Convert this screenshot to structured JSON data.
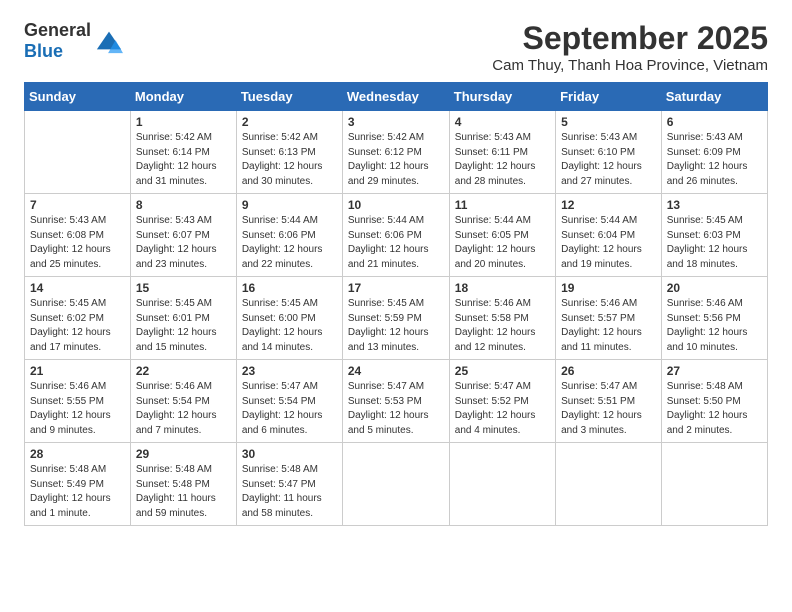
{
  "header": {
    "logo_general": "General",
    "logo_blue": "Blue",
    "month": "September 2025",
    "location": "Cam Thuy, Thanh Hoa Province, Vietnam"
  },
  "weekdays": [
    "Sunday",
    "Monday",
    "Tuesday",
    "Wednesday",
    "Thursday",
    "Friday",
    "Saturday"
  ],
  "weeks": [
    [
      {
        "day": "",
        "info": ""
      },
      {
        "day": "1",
        "info": "Sunrise: 5:42 AM\nSunset: 6:14 PM\nDaylight: 12 hours\nand 31 minutes."
      },
      {
        "day": "2",
        "info": "Sunrise: 5:42 AM\nSunset: 6:13 PM\nDaylight: 12 hours\nand 30 minutes."
      },
      {
        "day": "3",
        "info": "Sunrise: 5:42 AM\nSunset: 6:12 PM\nDaylight: 12 hours\nand 29 minutes."
      },
      {
        "day": "4",
        "info": "Sunrise: 5:43 AM\nSunset: 6:11 PM\nDaylight: 12 hours\nand 28 minutes."
      },
      {
        "day": "5",
        "info": "Sunrise: 5:43 AM\nSunset: 6:10 PM\nDaylight: 12 hours\nand 27 minutes."
      },
      {
        "day": "6",
        "info": "Sunrise: 5:43 AM\nSunset: 6:09 PM\nDaylight: 12 hours\nand 26 minutes."
      }
    ],
    [
      {
        "day": "7",
        "info": "Sunrise: 5:43 AM\nSunset: 6:08 PM\nDaylight: 12 hours\nand 25 minutes."
      },
      {
        "day": "8",
        "info": "Sunrise: 5:43 AM\nSunset: 6:07 PM\nDaylight: 12 hours\nand 23 minutes."
      },
      {
        "day": "9",
        "info": "Sunrise: 5:44 AM\nSunset: 6:06 PM\nDaylight: 12 hours\nand 22 minutes."
      },
      {
        "day": "10",
        "info": "Sunrise: 5:44 AM\nSunset: 6:06 PM\nDaylight: 12 hours\nand 21 minutes."
      },
      {
        "day": "11",
        "info": "Sunrise: 5:44 AM\nSunset: 6:05 PM\nDaylight: 12 hours\nand 20 minutes."
      },
      {
        "day": "12",
        "info": "Sunrise: 5:44 AM\nSunset: 6:04 PM\nDaylight: 12 hours\nand 19 minutes."
      },
      {
        "day": "13",
        "info": "Sunrise: 5:45 AM\nSunset: 6:03 PM\nDaylight: 12 hours\nand 18 minutes."
      }
    ],
    [
      {
        "day": "14",
        "info": "Sunrise: 5:45 AM\nSunset: 6:02 PM\nDaylight: 12 hours\nand 17 minutes."
      },
      {
        "day": "15",
        "info": "Sunrise: 5:45 AM\nSunset: 6:01 PM\nDaylight: 12 hours\nand 15 minutes."
      },
      {
        "day": "16",
        "info": "Sunrise: 5:45 AM\nSunset: 6:00 PM\nDaylight: 12 hours\nand 14 minutes."
      },
      {
        "day": "17",
        "info": "Sunrise: 5:45 AM\nSunset: 5:59 PM\nDaylight: 12 hours\nand 13 minutes."
      },
      {
        "day": "18",
        "info": "Sunrise: 5:46 AM\nSunset: 5:58 PM\nDaylight: 12 hours\nand 12 minutes."
      },
      {
        "day": "19",
        "info": "Sunrise: 5:46 AM\nSunset: 5:57 PM\nDaylight: 12 hours\nand 11 minutes."
      },
      {
        "day": "20",
        "info": "Sunrise: 5:46 AM\nSunset: 5:56 PM\nDaylight: 12 hours\nand 10 minutes."
      }
    ],
    [
      {
        "day": "21",
        "info": "Sunrise: 5:46 AM\nSunset: 5:55 PM\nDaylight: 12 hours\nand 9 minutes."
      },
      {
        "day": "22",
        "info": "Sunrise: 5:46 AM\nSunset: 5:54 PM\nDaylight: 12 hours\nand 7 minutes."
      },
      {
        "day": "23",
        "info": "Sunrise: 5:47 AM\nSunset: 5:54 PM\nDaylight: 12 hours\nand 6 minutes."
      },
      {
        "day": "24",
        "info": "Sunrise: 5:47 AM\nSunset: 5:53 PM\nDaylight: 12 hours\nand 5 minutes."
      },
      {
        "day": "25",
        "info": "Sunrise: 5:47 AM\nSunset: 5:52 PM\nDaylight: 12 hours\nand 4 minutes."
      },
      {
        "day": "26",
        "info": "Sunrise: 5:47 AM\nSunset: 5:51 PM\nDaylight: 12 hours\nand 3 minutes."
      },
      {
        "day": "27",
        "info": "Sunrise: 5:48 AM\nSunset: 5:50 PM\nDaylight: 12 hours\nand 2 minutes."
      }
    ],
    [
      {
        "day": "28",
        "info": "Sunrise: 5:48 AM\nSunset: 5:49 PM\nDaylight: 12 hours\nand 1 minute."
      },
      {
        "day": "29",
        "info": "Sunrise: 5:48 AM\nSunset: 5:48 PM\nDaylight: 11 hours\nand 59 minutes."
      },
      {
        "day": "30",
        "info": "Sunrise: 5:48 AM\nSunset: 5:47 PM\nDaylight: 11 hours\nand 58 minutes."
      },
      {
        "day": "",
        "info": ""
      },
      {
        "day": "",
        "info": ""
      },
      {
        "day": "",
        "info": ""
      },
      {
        "day": "",
        "info": ""
      }
    ]
  ]
}
